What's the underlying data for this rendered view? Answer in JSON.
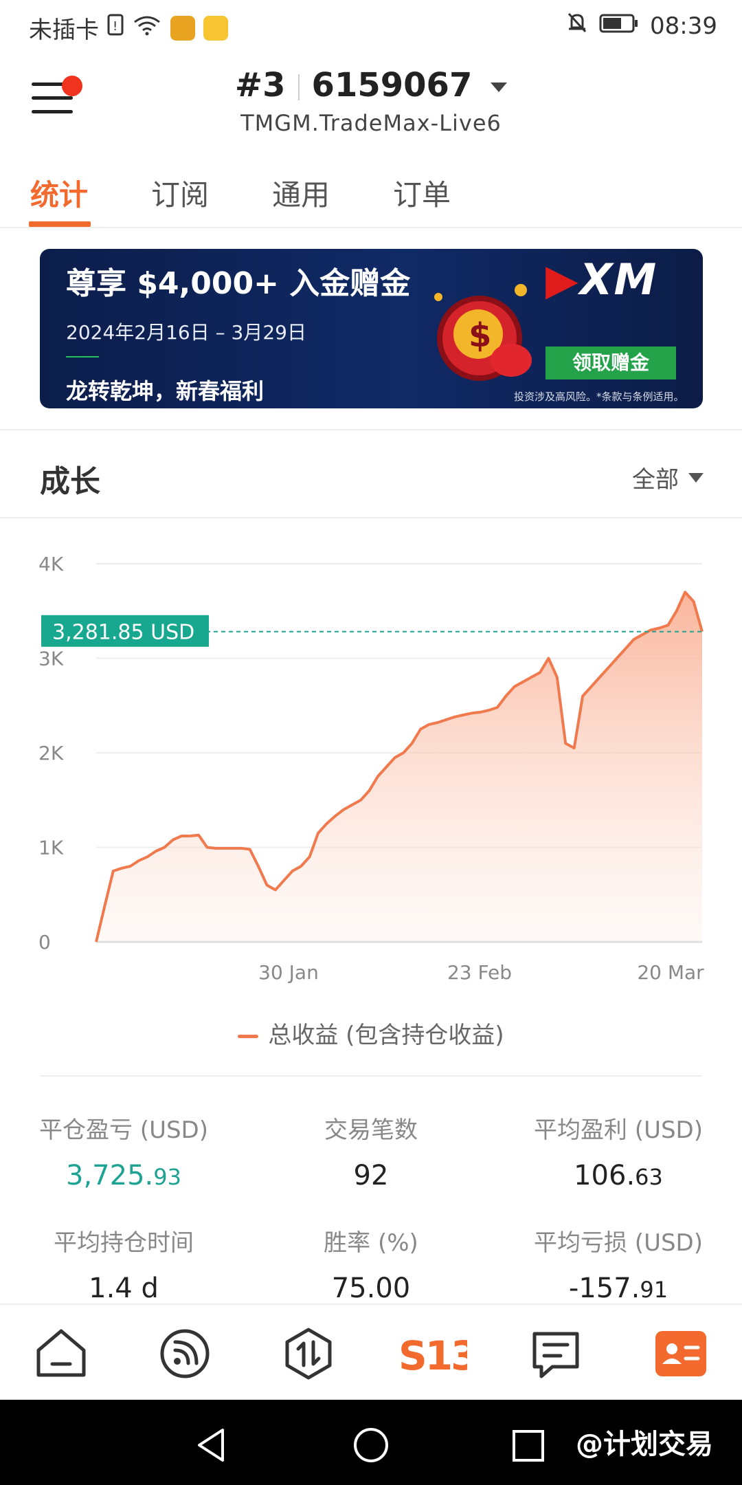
{
  "status_bar": {
    "carrier": "未插卡",
    "time": "08:39",
    "icons": [
      "sim-icon",
      "wifi-icon",
      "app-notification-icon",
      "folder-icon",
      "bell-off-icon",
      "battery-icon"
    ]
  },
  "header": {
    "account_index": "#3",
    "account_number": "6159067",
    "server": "TMGM.TradeMax-Live6"
  },
  "tabs": [
    "统计",
    "订阅",
    "通用",
    "订单"
  ],
  "banner": {
    "title": "尊享 $4,000+ 入金赠金",
    "date": "2024年2月16日 – 3月29日",
    "subtitle": "龙转乾坤，新春福利",
    "logo": "XM",
    "cta": "领取赠金",
    "disclaimer": "投资涉及高风险。*条款与条例适用。",
    "colors": {
      "background": "#0f2760",
      "cta": "#23a24a",
      "logo_accent": "#e01b1b"
    }
  },
  "growth": {
    "title": "成长",
    "filter": "全部"
  },
  "chart_data": {
    "type": "area",
    "y_ticks": [
      "0",
      "1K",
      "2K",
      "3K",
      "4K"
    ],
    "ylim": [
      0,
      4000
    ],
    "x_ticks": [
      "30 Jan",
      "23 Feb",
      "20 Mar"
    ],
    "current_value_label": "3,281.85 USD",
    "current_value": 3281.85,
    "series": [
      {
        "name": "总收益 (包含持仓收益)",
        "color": "#f07a4e",
        "values": [
          0,
          380,
          750,
          780,
          800,
          860,
          900,
          960,
          1000,
          1080,
          1120,
          1120,
          1130,
          1000,
          990,
          990,
          990,
          990,
          980,
          800,
          600,
          550,
          650,
          750,
          800,
          900,
          1150,
          1250,
          1330,
          1400,
          1450,
          1500,
          1600,
          1750,
          1850,
          1950,
          2000,
          2100,
          2250,
          2300,
          2320,
          2350,
          2380,
          2400,
          2420,
          2430,
          2450,
          2480,
          2600,
          2700,
          2750,
          2800,
          2850,
          3000,
          2800,
          2100,
          2050,
          2600,
          2700,
          2800,
          2900,
          3000,
          3100,
          3200,
          3250,
          3300,
          3320,
          3350,
          3500,
          3700,
          3600,
          3281.85
        ]
      }
    ],
    "grid": true,
    "colors": {
      "line": "#f07a4e",
      "fill": "#fde2d6",
      "label_bg": "#18a88f",
      "dashed": "#1ea392"
    }
  },
  "stats": [
    {
      "label": "平仓盈亏 (USD)",
      "int": "3,725.",
      "dec": "93",
      "green": true
    },
    {
      "label": "交易笔数",
      "int": "92",
      "dec": "",
      "green": false
    },
    {
      "label": "平均盈利 (USD)",
      "int": "106.",
      "dec": "63",
      "green": false
    },
    {
      "label": "平均持仓时间",
      "int": "1.4 d",
      "dec": "",
      "green": false
    },
    {
      "label": "胜率 (%)",
      "int": "75.00",
      "dec": "",
      "green": false
    },
    {
      "label": "平均亏损 (USD)",
      "int": "-157.",
      "dec": "91",
      "green": false
    }
  ],
  "bottom_nav": [
    "home-icon",
    "signals-icon",
    "trade-icon",
    "s13-logo-icon",
    "news-icon",
    "profile-card-icon"
  ],
  "watermark": "@计划交易"
}
